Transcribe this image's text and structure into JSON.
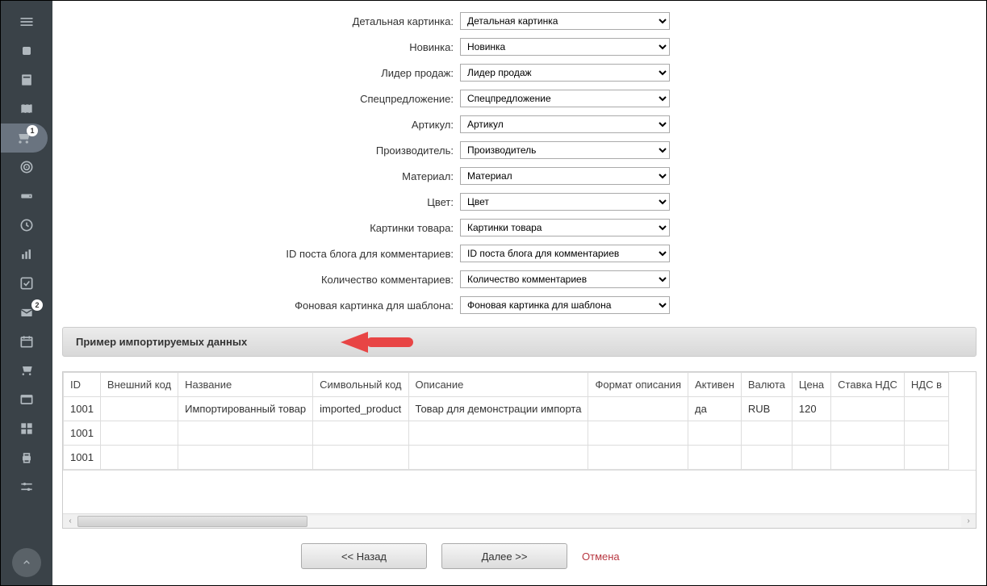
{
  "sidebar": {
    "badges": {
      "item4": "1",
      "item11": "2"
    }
  },
  "form": {
    "rows": [
      {
        "label": "Детальная картинка:",
        "value": "Детальная картинка"
      },
      {
        "label": "Новинка:",
        "value": "Новинка"
      },
      {
        "label": "Лидер продаж:",
        "value": "Лидер продаж"
      },
      {
        "label": "Спецпредложение:",
        "value": "Спецпредложение"
      },
      {
        "label": "Артикул:",
        "value": "Артикул"
      },
      {
        "label": "Производитель:",
        "value": "Производитель"
      },
      {
        "label": "Материал:",
        "value": "Материал"
      },
      {
        "label": "Цвет:",
        "value": "Цвет"
      },
      {
        "label": "Картинки товара:",
        "value": "Картинки товара"
      },
      {
        "label": "ID поста блога для комментариев:",
        "value": "ID поста блога для комментариев"
      },
      {
        "label": "Количество комментариев:",
        "value": "Количество комментариев"
      },
      {
        "label": "Фоновая картинка для шаблона:",
        "value": "Фоновая картинка для шаблона"
      }
    ]
  },
  "section_title": "Пример импортируемых данных",
  "table": {
    "headers": [
      "ID",
      "Внешний код",
      "Название",
      "Символьный код",
      "Описание",
      "Формат описания",
      "Активен",
      "Валюта",
      "Цена",
      "Ставка НДС",
      "НДС в"
    ],
    "rows": [
      {
        "cells": [
          "1001",
          "",
          "Импортированный товар",
          "imported_product",
          "Товар для демонстрации импорта",
          "",
          "да",
          "RUB",
          "120",
          "",
          ""
        ]
      },
      {
        "cells": [
          "1001",
          "",
          "",
          "",
          "",
          "",
          "",
          "",
          "",
          "",
          ""
        ]
      },
      {
        "cells": [
          "1001",
          "",
          "",
          "",
          "",
          "",
          "",
          "",
          "",
          "",
          ""
        ]
      }
    ]
  },
  "buttons": {
    "back": "<< Назад",
    "next": "Далее >>",
    "cancel": "Отмена"
  }
}
